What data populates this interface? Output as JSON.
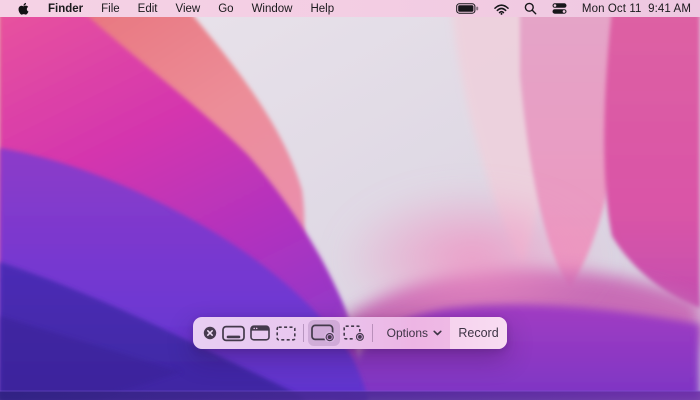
{
  "menu_bar": {
    "apple_menu": "apple-logo",
    "items": [
      {
        "label": "Finder",
        "bold": true
      },
      {
        "label": "File"
      },
      {
        "label": "Edit"
      },
      {
        "label": "View"
      },
      {
        "label": "Go"
      },
      {
        "label": "Window"
      },
      {
        "label": "Help"
      }
    ],
    "status_icons": [
      "battery-icon",
      "wifi-icon",
      "search-icon",
      "control-center-icon"
    ],
    "clock": "Mon Oct 11  9:41 AM"
  },
  "screenshot_toolbar": {
    "close_button": "close",
    "capture_buttons": [
      {
        "name": "capture-entire-screen",
        "selected": false
      },
      {
        "name": "capture-selected-window",
        "selected": false
      },
      {
        "name": "capture-selected-portion",
        "selected": false
      }
    ],
    "record_buttons": [
      {
        "name": "record-entire-screen",
        "selected": true
      },
      {
        "name": "record-selected-portion",
        "selected": false
      }
    ],
    "options_label": "Options",
    "record_label": "Record"
  },
  "colors": {
    "menubar_bg": "#f3cde3",
    "toolbar_bg_left": "#e8cef3",
    "toolbar_bg_right": "#f2c0e7",
    "record_segment_bg": "#f8dcf2",
    "toolbar_icon": "#443a4c",
    "wallpaper_palette": [
      "#e8757c",
      "#d435ae",
      "#de5fa2",
      "#e79fc4",
      "#dcd4e3",
      "#7b3bd4",
      "#452bb0",
      "#8a38c6"
    ]
  }
}
